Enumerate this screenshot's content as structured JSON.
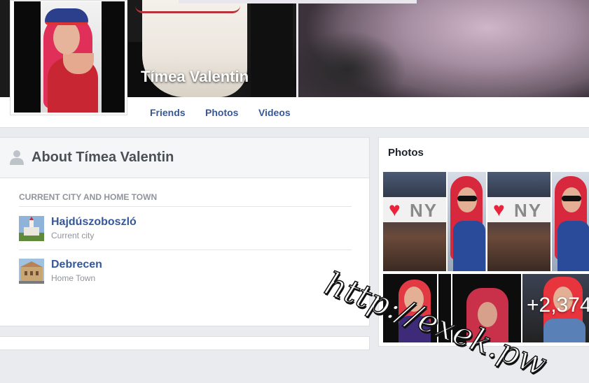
{
  "profile": {
    "name": "Tímea Valentin"
  },
  "nav": {
    "tabs": [
      "Friends",
      "Photos",
      "Videos"
    ]
  },
  "about": {
    "title": "About Tímea Valentin",
    "section_label": "CURRENT CITY AND HOME TOWN",
    "places": [
      {
        "name": "Hajdúszoboszló",
        "type": "Current city"
      },
      {
        "name": "Debrecen",
        "type": "Home Town"
      }
    ]
  },
  "photos": {
    "title": "Photos",
    "store_sign_text": "NY",
    "more_count": "+2,374"
  },
  "watermark": "http://exek.pw",
  "colors": {
    "link": "#365899",
    "muted": "#90949c",
    "page_bg": "#e9ebee"
  }
}
